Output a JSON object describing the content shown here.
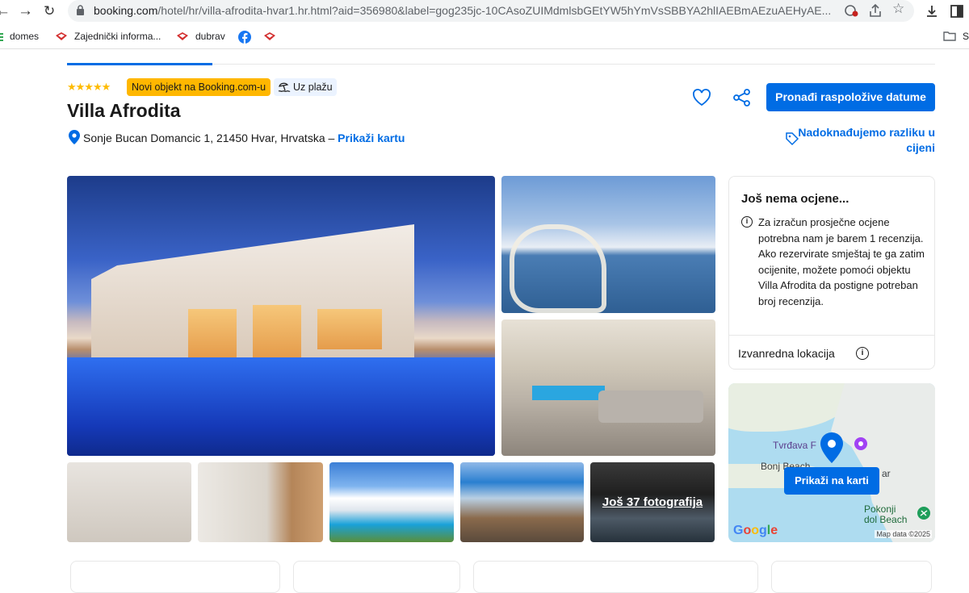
{
  "browser": {
    "url_host": "booking.com",
    "url_path": "/hotel/hr/villa-afrodita-hvar1.hr.html?aid=356980&label=gog235jc-10CAsoZUIMdmlsbGEtYW5hYmVsSBBYA2hlIAEBmAEzuAEHyAE...",
    "bookmarks": [
      {
        "label": "domes"
      },
      {
        "label": "Zajednički informa..."
      },
      {
        "label": "dubrav"
      },
      {
        "label": ""
      },
      {
        "label": ""
      }
    ],
    "bookmarks_right": "S"
  },
  "property": {
    "stars": "★★★★★",
    "new_badge": "Novi objekt na Booking.com-u",
    "beach_badge": "Uz plažu",
    "name": "Villa Afrodita",
    "address": "Sonje Bucan Domancic 1, 21450 Hvar, Hrvatska –",
    "map_link": "Prikaži kartu",
    "cta": "Pronađi raspoložive datume",
    "price_match": "Nadoknađujemo razliku u cijeni"
  },
  "gallery": {
    "more_photos": "Još 37 fotografija"
  },
  "review": {
    "title": "Još nema ocjene...",
    "text": "Za izračun prosječne ocjene potrebna nam je barem 1 recenzija. Ako rezervirate smještaj te ga zatim ocijenite, možete pomoći objektu Villa Afrodita da postigne potreban broj recenzija.",
    "location": "Izvanredna lokacija"
  },
  "map": {
    "button": "Prikaži na karti",
    "label_fortress": "Tvrđava F",
    "label_beach1": "Bonj Beach",
    "label_beach2": "Pokonji\ndol Beach",
    "label_partial": "ar",
    "logo": "Google",
    "attribution": "Map data ©2025"
  },
  "colors": {
    "brand_blue": "#006ce4",
    "new_badge": "#ffb700",
    "star": "#febb02"
  }
}
